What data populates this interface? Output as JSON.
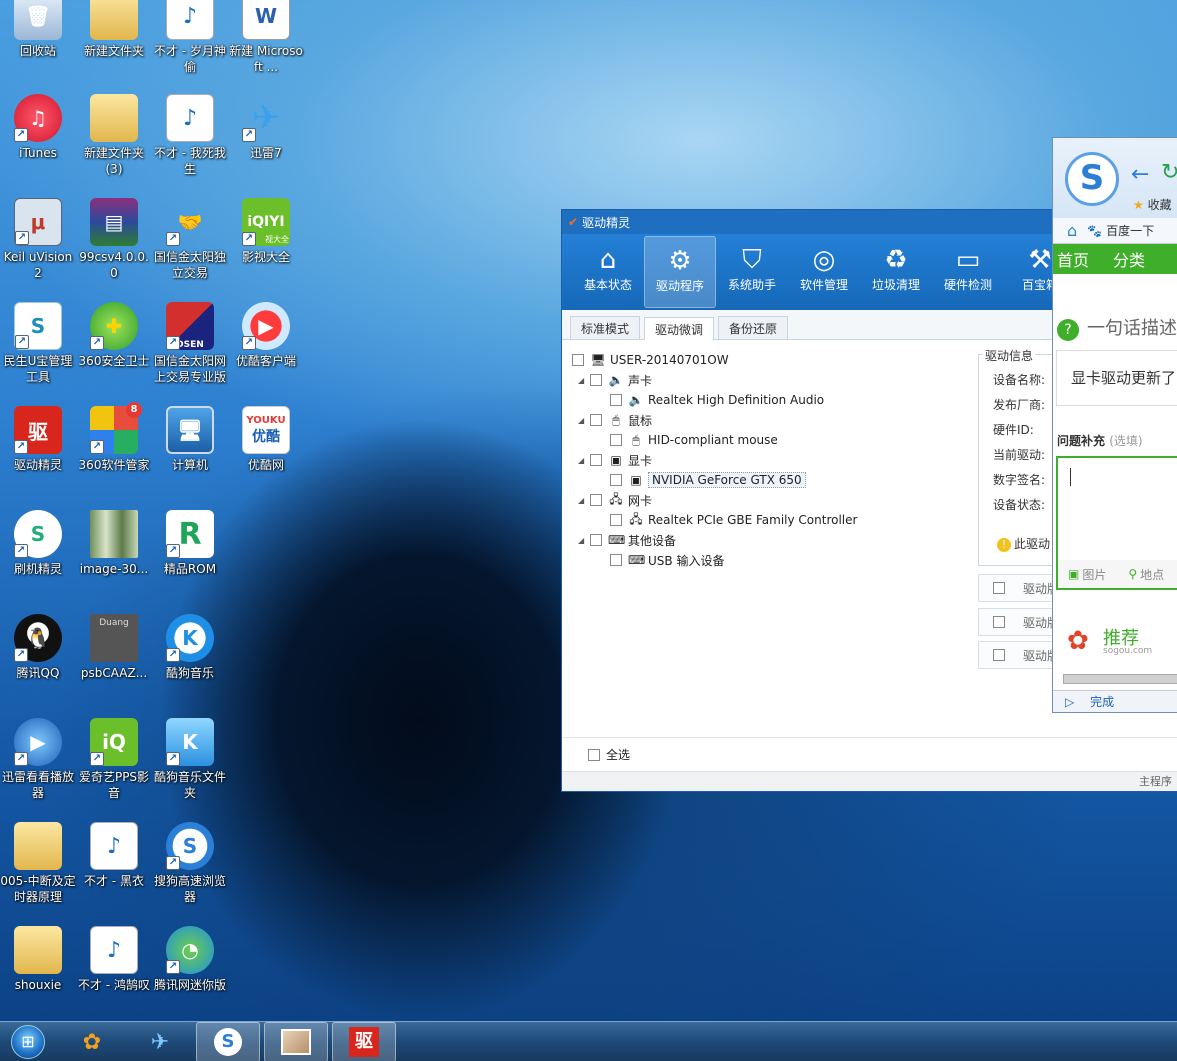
{
  "desktop": {
    "icons": [
      {
        "label": "回收站"
      },
      {
        "label": "新建文件夹"
      },
      {
        "label": "不才 - 岁月神偷"
      },
      {
        "label": "新建 Microsoft ..."
      },
      {
        "label": "iTunes"
      },
      {
        "label": "新建文件夹 (3)"
      },
      {
        "label": "不才 - 我死我生"
      },
      {
        "label": "迅雷7"
      },
      {
        "label": "Keil uVision2"
      },
      {
        "label": "99csv4.0.0.0"
      },
      {
        "label": "国信金太阳独立交易"
      },
      {
        "label": "影视大全"
      },
      {
        "label": "民生U宝管理工具"
      },
      {
        "label": "360安全卫士"
      },
      {
        "label": "国信金太阳网上交易专业版"
      },
      {
        "label": "优酷客户端"
      },
      {
        "label": "驱动精灵"
      },
      {
        "label": "360软件管家"
      },
      {
        "label": "计算机"
      },
      {
        "label": "优酷网"
      },
      {
        "label": "刷机精灵"
      },
      {
        "label": "image-30..."
      },
      {
        "label": "精品ROM"
      },
      {
        "label": "腾讯QQ"
      },
      {
        "label": "psbCAAZ..."
      },
      {
        "label": "酷狗音乐"
      },
      {
        "label": "迅雷看看播放器"
      },
      {
        "label": "爱奇艺PPS影音"
      },
      {
        "label": "酷狗音乐文件夹"
      },
      {
        "label": "005-中断及定时器原理"
      },
      {
        "label": "不才 - 黑衣"
      },
      {
        "label": "搜狗高速浏览器"
      },
      {
        "label": "shouxie"
      },
      {
        "label": "不才 - 鸿鹄叹"
      },
      {
        "label": "腾讯网迷你版"
      }
    ],
    "badges": {
      "iqiyi_corner": "视大全",
      "duang": "Duang",
      "youku_cn": "优酷",
      "youku_en": "YOUKU",
      "qu": "驱",
      "ds": "DSEN",
      "count": "8"
    }
  },
  "driver_window": {
    "title": "驱动精灵",
    "toolbar": [
      {
        "label": "基本状态"
      },
      {
        "label": "驱动程序"
      },
      {
        "label": "系统助手"
      },
      {
        "label": "软件管理"
      },
      {
        "label": "垃圾清理"
      },
      {
        "label": "硬件检测"
      },
      {
        "label": "百宝箱"
      }
    ],
    "tabs": [
      {
        "label": "标准模式"
      },
      {
        "label": "驱动微调"
      },
      {
        "label": "备份还原"
      }
    ],
    "tree": {
      "root": "USER-20140701OW",
      "groups": [
        {
          "category": "声卡",
          "device": "Realtek High Definition Audio"
        },
        {
          "category": "鼠标",
          "device": "HID-compliant mouse"
        },
        {
          "category": "显卡",
          "device": "NVIDIA GeForce GTX 650"
        },
        {
          "category": "网卡",
          "device": "Realtek PCIe GBE Family Controller"
        },
        {
          "category": "其他设备",
          "device": "USB 输入设备"
        }
      ]
    },
    "info": {
      "header": "驱动信息",
      "fields": [
        "设备名称:",
        "发布厂商:",
        "硬件ID:",
        "当前驱动:",
        "数字签名:",
        "设备状态:"
      ],
      "warning": "此驱动"
    },
    "driver_rows": [
      "驱动版",
      "驱动版",
      "驱动版"
    ],
    "select_all": "全选",
    "status": "主程序"
  },
  "sogou_window": {
    "favorites": "收藏",
    "nav_item": "百度一下",
    "green_nav": [
      "首页",
      "分类"
    ],
    "question": "一句话描述",
    "answer": "显卡驱动更新了",
    "supplement_label": "问题补充",
    "supplement_hint": "(选填)",
    "attach_image": "图片",
    "attach_location": "地点",
    "recommend": "推荐",
    "recommend_site": "sogou.com",
    "done": "完成"
  },
  "taskbar": {
    "buttons": [
      "搜狗浏览器",
      "迅雷",
      "搜狗高速浏览器",
      "图片",
      "驱动精灵"
    ]
  }
}
